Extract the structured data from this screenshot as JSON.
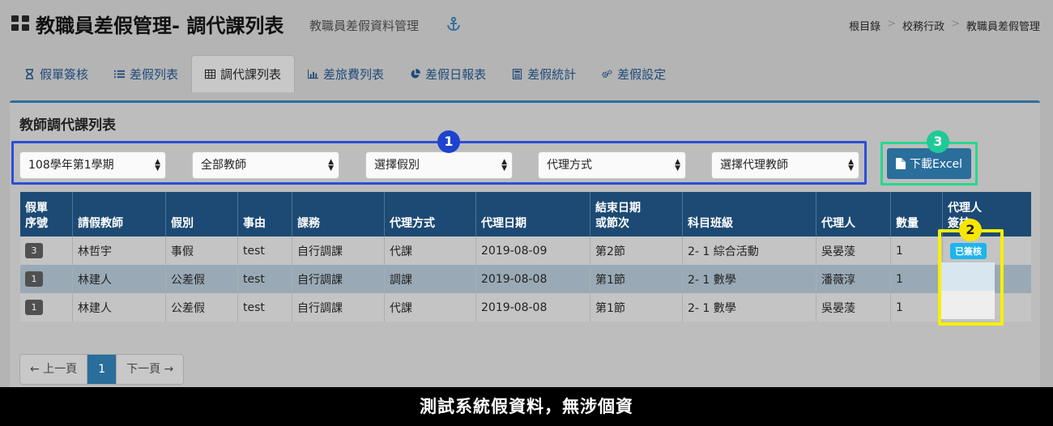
{
  "header": {
    "title": "教職員差假管理- 調代課列表",
    "subtitle": "教職員差假資料管理",
    "breadcrumb": [
      "根目錄",
      "校務行政",
      "教職員差假管理"
    ]
  },
  "tabs": [
    {
      "label": "假單簽核",
      "icon": "hourglass-icon"
    },
    {
      "label": "差假列表",
      "icon": "list-icon"
    },
    {
      "label": "調代課列表",
      "icon": "table-icon",
      "active": true
    },
    {
      "label": "差旅費列表",
      "icon": "bar-chart-icon"
    },
    {
      "label": "差假日報表",
      "icon": "pie-chart-icon"
    },
    {
      "label": "差假統計",
      "icon": "calculator-icon"
    },
    {
      "label": "差假設定",
      "icon": "cogs-icon"
    }
  ],
  "panel": {
    "title": "教師調代課列表",
    "filters": [
      "108學年第1學期",
      "全部教師",
      "選擇假別",
      "代理方式",
      "選擇代理教師"
    ],
    "export_label": "下載Excel",
    "annotations": [
      "1",
      "2",
      "3"
    ]
  },
  "table": {
    "headers": [
      "假單\n序號",
      "請假教師",
      "假別",
      "事由",
      "課務",
      "代理方式",
      "代理日期",
      "結束日期\n或節次",
      "科目班級",
      "代理人",
      "數量",
      "代理人\n簽核"
    ],
    "rows": [
      [
        "3",
        "林哲宇",
        "事假",
        "test",
        "自行調課",
        "代課",
        "2019-08-09",
        "第2節",
        "2- 1 綜合活動",
        "吳晏蔆",
        "1",
        "已簽核"
      ],
      [
        "1",
        "林建人",
        "公差假",
        "test",
        "自行調課",
        "調課",
        "2019-08-08",
        "第1節",
        "2- 1 數學",
        "潘薇淳",
        "1",
        ""
      ],
      [
        "1",
        "林建人",
        "公差假",
        "test",
        "自行調課",
        "代課",
        "2019-08-08",
        "第1節",
        "2- 1 數學",
        "吳晏蔆",
        "1",
        ""
      ]
    ]
  },
  "pagination": {
    "prev": "← 上一頁",
    "current": "1",
    "next": "下一頁 →"
  },
  "caption": "測試系統假資料，無涉個資",
  "colors": {
    "header_bg": "#1c4a74",
    "accent": "#2a6e9c",
    "box1": "#2b4fd6",
    "box2": "#f7f000",
    "box3": "#25d88f"
  }
}
